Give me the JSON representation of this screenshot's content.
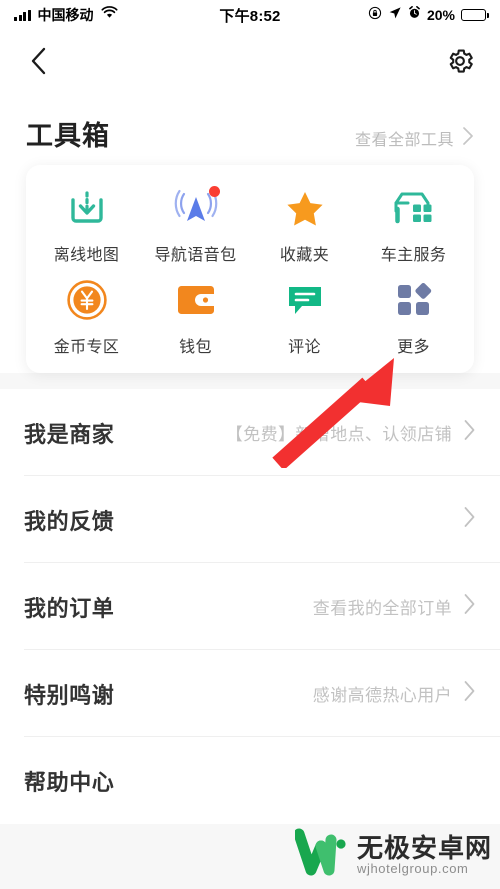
{
  "statusbar": {
    "carrier": "中国移动",
    "time": "下午8:52",
    "battery_pct": "20%",
    "signal_icon": "signal-bars-icon",
    "wifi_icon": "wifi-icon",
    "rotation_lock_icon": "rotation-lock-icon",
    "location_icon": "location-arrow-icon",
    "alarm_icon": "alarm-clock-icon",
    "battery_icon": "battery-low-icon"
  },
  "navbar": {
    "back_icon": "back-chevron-icon",
    "settings_icon": "gear-icon"
  },
  "toolbox": {
    "title": "工具箱",
    "view_all_label": "查看全部工具",
    "view_all_icon": "chevron-right-icon",
    "tools": [
      {
        "label": "离线地图",
        "icon": "offline-map-download-icon",
        "color": "#2fb89a",
        "badge": false
      },
      {
        "label": "导航语音包",
        "icon": "navigation-voice-icon",
        "color": "#5b7ce8",
        "badge": true
      },
      {
        "label": "收藏夹",
        "icon": "star-icon",
        "color": "#f79a1e",
        "badge": false
      },
      {
        "label": "车主服务",
        "icon": "car-service-icon",
        "color": "#2fb89a",
        "badge": false
      },
      {
        "label": "金币专区",
        "icon": "gold-coin-icon",
        "color": "#f2871e",
        "badge": false
      },
      {
        "label": "钱包",
        "icon": "wallet-icon",
        "color": "#f2871e",
        "badge": false
      },
      {
        "label": "评论",
        "icon": "comment-bubble-icon",
        "color": "#12b886",
        "badge": false
      },
      {
        "label": "更多",
        "icon": "more-grid-icon",
        "color": "#6e7ba5",
        "badge": false
      }
    ]
  },
  "list": {
    "rows": [
      {
        "title": "我是商家",
        "sub": "【免费】新增地点、认领店铺",
        "chevron": "chevron-right-icon"
      },
      {
        "title": "我的反馈",
        "sub": "",
        "chevron": "chevron-right-icon"
      },
      {
        "title": "我的订单",
        "sub": "查看我的全部订单",
        "chevron": "chevron-right-icon"
      },
      {
        "title": "特别鸣谢",
        "sub": "感谢高德热心用户",
        "chevron": "chevron-right-icon"
      },
      {
        "title": "帮助中心",
        "sub": "",
        "chevron": "chevron-right-icon"
      }
    ]
  },
  "annotation": {
    "arrow_icon": "red-pointer-arrow",
    "arrow_color": "#f23030",
    "points_to": "更多"
  },
  "watermark": {
    "logo_icon": "w-logo-icon",
    "name_cn": "无极安卓网",
    "name_en": "wjhotelgroup.com",
    "logo_color": "#1faa55"
  }
}
